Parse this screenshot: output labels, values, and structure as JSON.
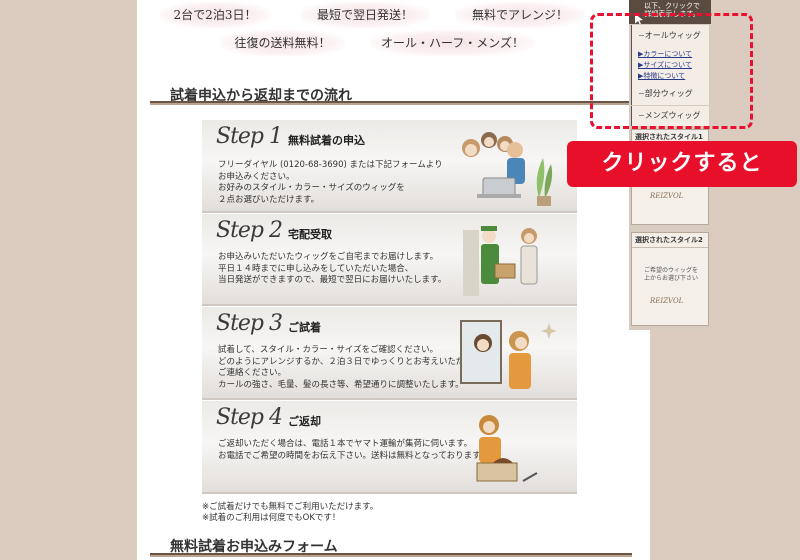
{
  "features": {
    "pill1": "2台で2泊3日！",
    "pill2": "最短で翌日発送！",
    "pill3": "無料でアレンジ！",
    "pill4": "往復の送料無料！",
    "pill5": "オール・ハーフ・メンズ！"
  },
  "section1": {
    "title": "試着申込から返却までの流れ"
  },
  "steps": [
    {
      "script": "Step 1",
      "name": "無料試着の申込",
      "desc": "フリーダイヤル (0120-68-3690) または下記フォームより\nお申込みください。\nお好みのスタイル・カラー・サイズのウィッグを\n２点お選びいただけます。"
    },
    {
      "script": "Step 2",
      "name": "宅配受取",
      "desc": "お申込みいただいたウィッグをご自宅までお届けします。\n平日１４時までに申し込みをしていただいた場合、\n当日発送ができますので、最短で翌日にお届けいたします。"
    },
    {
      "script": "Step 3",
      "name": "ご試着",
      "desc": "試着して、スタイル・カラー・サイズをご確認ください。\nどのようにアレンジするか、２泊３日でゆっくりとお考えいただき、\nご連絡ください。\nカールの強さ、毛量、髪の長さ等、希望通りに調整いたします。"
    },
    {
      "script": "Step 4",
      "name": "ご返却",
      "desc": "ご返却いただく場合は、電話１本でヤマト運輸が集荷に伺います。\nお電話でご希望の時間をお伝え下さい。送料は無料となっております。"
    }
  ],
  "notes": "※ご試着だけでも無料でご利用いただけます。\n※試着のご利用は何度でもOKです！",
  "section2": {
    "title": "無料試着お申込みフォーム"
  },
  "sidebar": {
    "header": "以下、クリックで\n詳細表示します。",
    "items": [
      {
        "label": "オールウィッグ"
      },
      {
        "label": "部分ウィッグ"
      },
      {
        "label": "メンズウィッグ"
      }
    ],
    "sub_links": [
      "▶カラーについて",
      "▶サイズについて",
      "▶特徴について"
    ],
    "selected1": "選択されたスタイル1",
    "selected2": "選択されたスタイル2",
    "placeholder_text": "ご希望のウィッグを\n上からお選び下さい",
    "logo_text": "REIZVOL"
  },
  "callout": {
    "text": "クリックすると"
  },
  "colors": {
    "highlight": "#e8112f",
    "sidebar_header": "#5a4a40",
    "background": "#dcccc0"
  }
}
